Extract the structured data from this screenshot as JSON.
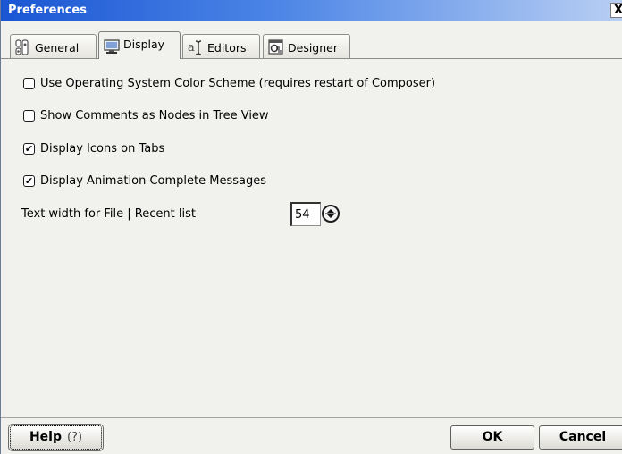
{
  "window": {
    "title": "Preferences",
    "close_label": "X"
  },
  "tabs": [
    {
      "label": "General",
      "icon": "general-sliders-icon",
      "active": false
    },
    {
      "label": "Display",
      "icon": "monitor-icon",
      "active": true
    },
    {
      "label": "Editors",
      "icon": "text-cursor-icon",
      "active": false
    },
    {
      "label": "Designer",
      "icon": "designer-window-icon",
      "active": false
    }
  ],
  "options": [
    {
      "label": "Use Operating System Color Scheme (requires restart of Composer)",
      "checked": false
    },
    {
      "label": "Show Comments as Nodes in Tree View",
      "checked": false
    },
    {
      "label": "Display Icons on Tabs",
      "checked": true
    },
    {
      "label": "Display Animation Complete Messages",
      "checked": true
    }
  ],
  "recent_list": {
    "label": "Text width for File | Recent list",
    "value": "54"
  },
  "buttons": {
    "help": "Help",
    "help_symbol": "?",
    "ok": "OK",
    "cancel": "Cancel"
  },
  "checkmark": "✔",
  "colors": {
    "titlebar_start": "#1a56d4",
    "titlebar_end": "#b9cff3",
    "panel": "#f1f1ee"
  }
}
